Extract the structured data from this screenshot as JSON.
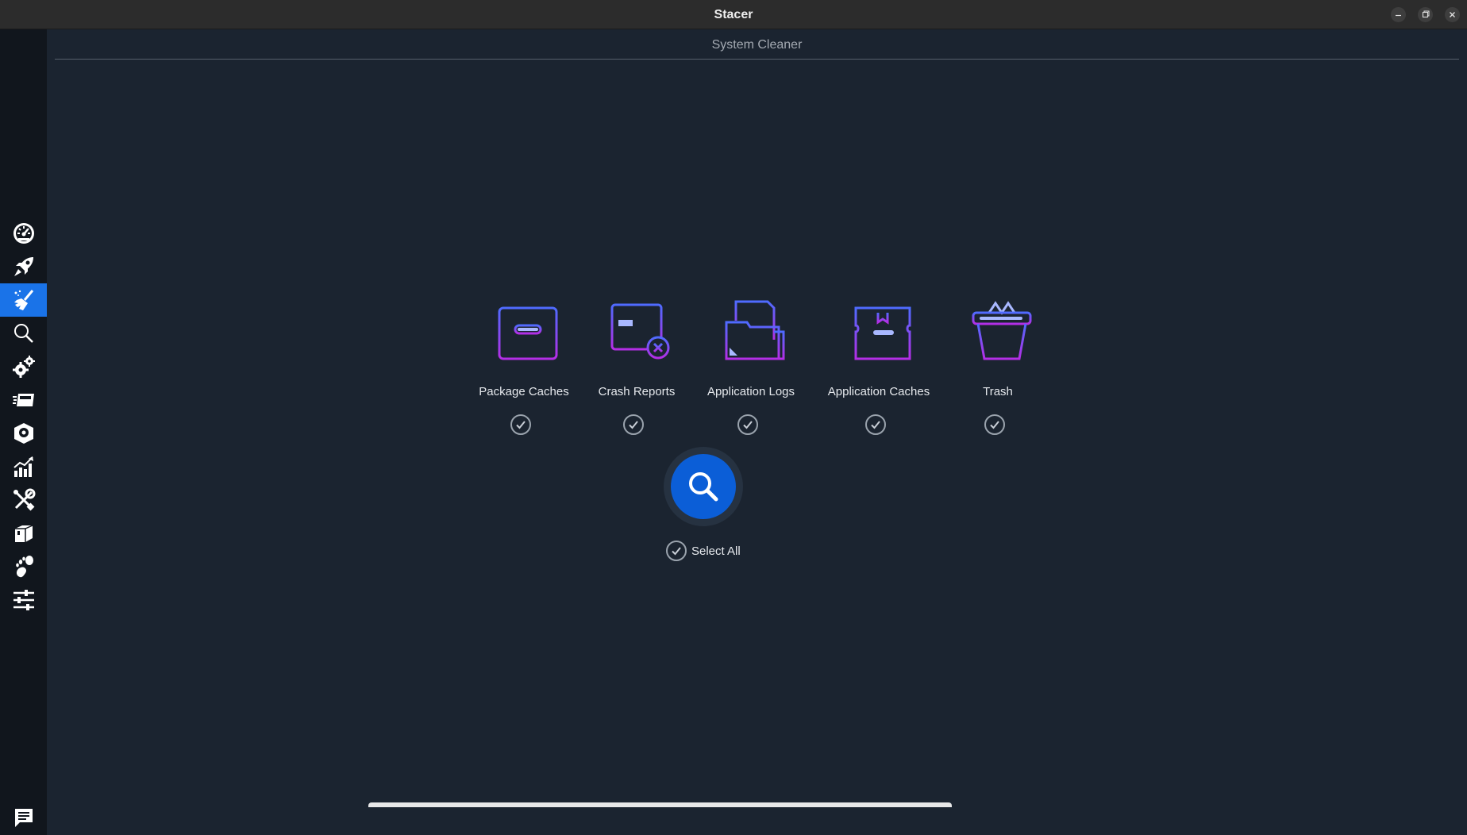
{
  "window": {
    "title": "Stacer"
  },
  "page": {
    "title": "System Cleaner"
  },
  "sidebar": {
    "items": [
      {
        "name": "dashboard",
        "icon": "speedometer-icon",
        "active": false
      },
      {
        "name": "startup-apps",
        "icon": "rocket-icon",
        "active": false
      },
      {
        "name": "system-cleaner",
        "icon": "broom-icon",
        "active": true
      },
      {
        "name": "search",
        "icon": "search-icon",
        "active": false
      },
      {
        "name": "services",
        "icon": "gears-icon",
        "active": false
      },
      {
        "name": "processes",
        "icon": "processes-icon",
        "active": false
      },
      {
        "name": "uninstaller",
        "icon": "package-icon",
        "active": false
      },
      {
        "name": "resources",
        "icon": "chart-icon",
        "active": false
      },
      {
        "name": "helpers",
        "icon": "tools-icon",
        "active": false
      },
      {
        "name": "apt-repository",
        "icon": "boxes-icon",
        "active": false
      },
      {
        "name": "gnome-settings",
        "icon": "gnome-foot-icon",
        "active": false
      },
      {
        "name": "settings",
        "icon": "sliders-icon",
        "active": false
      },
      {
        "name": "feedback",
        "icon": "chat-icon",
        "active": false
      }
    ]
  },
  "categories": [
    {
      "label": "Package Caches",
      "icon": "package-caches-icon",
      "checked": true
    },
    {
      "label": "Crash Reports",
      "icon": "crash-reports-icon",
      "checked": true
    },
    {
      "label": "Application Logs",
      "icon": "application-logs-icon",
      "checked": true
    },
    {
      "label": "Application Caches",
      "icon": "application-caches-icon",
      "checked": true
    },
    {
      "label": "Trash",
      "icon": "trash-icon",
      "checked": true
    }
  ],
  "select_all": {
    "label": "Select All",
    "checked": true
  },
  "colors": {
    "accent": "#1a73e8",
    "scan_button": "#0b5ed7",
    "icon_gradient_start": "#4f6bff",
    "icon_gradient_end": "#b52ee6",
    "background": "#1b2430",
    "sidebar": "#11161d"
  }
}
